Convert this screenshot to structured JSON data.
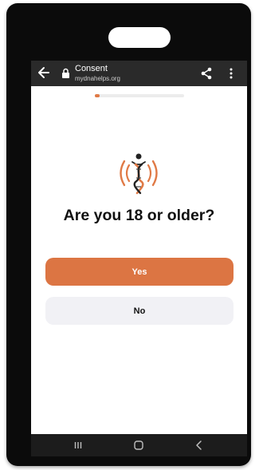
{
  "browser": {
    "page_title": "Consent",
    "domain": "mydnahelps.org"
  },
  "progress": {
    "fraction": 0.05,
    "color": "#e07a46"
  },
  "logo": {
    "icon": "dna-person-logo-icon",
    "color": "#e07a46"
  },
  "consent": {
    "question": "Are you 18 or older?",
    "yes_label": "Yes",
    "no_label": "No"
  },
  "colors": {
    "accent": "#dc7543",
    "secondary_button": "#f1f1f5",
    "browser_bar": "#2a2a2a",
    "nav_bar": "#1c1c1c"
  },
  "system_nav": {
    "icons": [
      "recent-apps-icon",
      "home-icon",
      "back-icon"
    ]
  }
}
